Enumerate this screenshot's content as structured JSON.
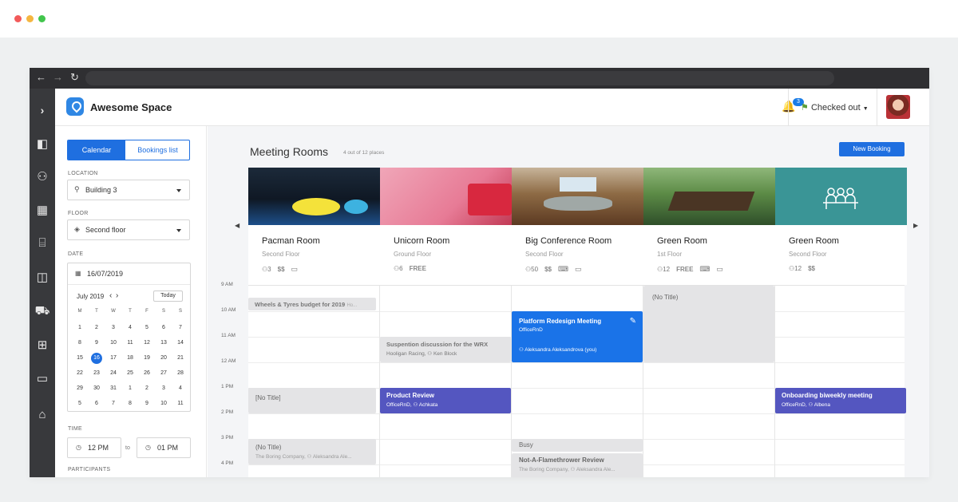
{
  "app": {
    "brand": "Awesome Space",
    "notification_count": "3",
    "status": "Checked out"
  },
  "sidebar": {
    "tabs": [
      "Calendar",
      "Bookings list"
    ],
    "location_label": "LOCATION",
    "location_value": "Building 3",
    "floor_label": "FLOOR",
    "floor_value": "Second floor",
    "date_label": "DATE",
    "date_value": "16/07/2019",
    "month_label": "July 2019",
    "today_label": "Today",
    "weekdays": [
      "M",
      "T",
      "W",
      "T",
      "F",
      "S",
      "S"
    ],
    "weeks": [
      [
        "1",
        "2",
        "3",
        "4",
        "5",
        "6",
        "7"
      ],
      [
        "8",
        "9",
        "10",
        "11",
        "12",
        "13",
        "14"
      ],
      [
        "15",
        "16",
        "17",
        "18",
        "19",
        "20",
        "21"
      ],
      [
        "22",
        "23",
        "24",
        "25",
        "26",
        "27",
        "28"
      ],
      [
        "29",
        "30",
        "31",
        "1",
        "2",
        "3",
        "4"
      ],
      [
        "5",
        "6",
        "7",
        "8",
        "9",
        "10",
        "11"
      ]
    ],
    "time_label": "TIME",
    "time_from": "12 PM",
    "time_to_label": "to",
    "time_to": "01 PM",
    "participants_label": "PARTICIPANTS"
  },
  "main": {
    "title": "Meeting Rooms",
    "subtitle": "4 out of 12 places",
    "new_booking": "New Booking"
  },
  "rooms": [
    {
      "name": "Pacman Room",
      "floor": "Second Floor",
      "capacity": "3",
      "price": "$$"
    },
    {
      "name": "Unicorn Room",
      "floor": "Ground Floor",
      "capacity": "6",
      "price": "FREE"
    },
    {
      "name": "Big Conference Room",
      "floor": "Second Floor",
      "capacity": "50",
      "price": "$$"
    },
    {
      "name": "Green Room",
      "floor": "1st Floor",
      "capacity": "12",
      "price": "FREE"
    },
    {
      "name": "Green Room",
      "floor": "Second Floor",
      "capacity": "12",
      "price": "$$"
    }
  ],
  "times": [
    "9 AM",
    "10 AM",
    "11 AM",
    "12 AM",
    "1 PM",
    "2 PM",
    "3 PM",
    "4 PM"
  ],
  "events": {
    "wheels": {
      "title": "Wheels & Tyres budget for 2019",
      "sub": "Ho..."
    },
    "suspention": {
      "title": "Suspention discussion for the WRX",
      "sub": "Hooligan Racing, ⚇ Ken Block"
    },
    "platform": {
      "title": "Platform Redesign Meeting",
      "sub1": "OfficeRnD",
      "sub2": "⚇ Aleksandra Aleksandrova (you)"
    },
    "notitle_green": {
      "title": "(No Title)"
    },
    "notitle_pac1": {
      "title": "[No Title]"
    },
    "product": {
      "title": "Product Review",
      "sub": "OfficeRnD, ⚇ Achkata"
    },
    "onboarding": {
      "title": "Onboarding biweekly meeting",
      "sub": "OfficeRnD, ⚇ Albena"
    },
    "notitle_pac2": {
      "title": "(No Title)",
      "sub": "The Boring Company, ⚇ Aleksandra Ale..."
    },
    "busy": {
      "title": "Busy"
    },
    "flamethrower": {
      "title": "Not-A-Flamethrower Review",
      "sub": "The Boring Company, ⚇ Aleksandra Ale..."
    }
  }
}
